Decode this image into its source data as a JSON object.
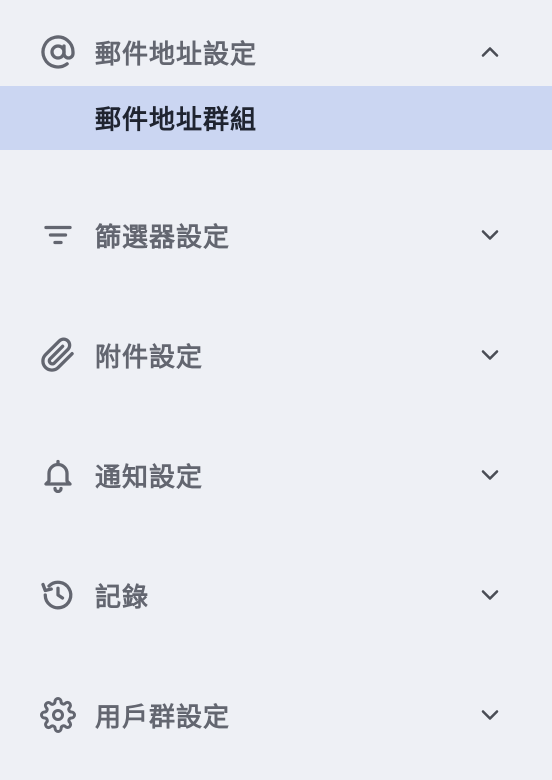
{
  "sidebar": {
    "sections": [
      {
        "label": "郵件地址設定",
        "icon": "at-sign-icon",
        "expanded": true,
        "children": [
          {
            "label": "郵件地址群組",
            "selected": true
          }
        ]
      },
      {
        "label": "篩選器設定",
        "icon": "filter-icon",
        "expanded": false
      },
      {
        "label": "附件設定",
        "icon": "paperclip-icon",
        "expanded": false
      },
      {
        "label": "通知設定",
        "icon": "bell-icon",
        "expanded": false
      },
      {
        "label": "記錄",
        "icon": "history-icon",
        "expanded": false
      },
      {
        "label": "用戶群設定",
        "icon": "gear-icon",
        "expanded": false
      }
    ]
  },
  "colors": {
    "background": "#eef0f5",
    "selected_background": "#cbd6f2",
    "label": "#636670",
    "selected_label": "#1f2430",
    "icon": "#636670"
  }
}
